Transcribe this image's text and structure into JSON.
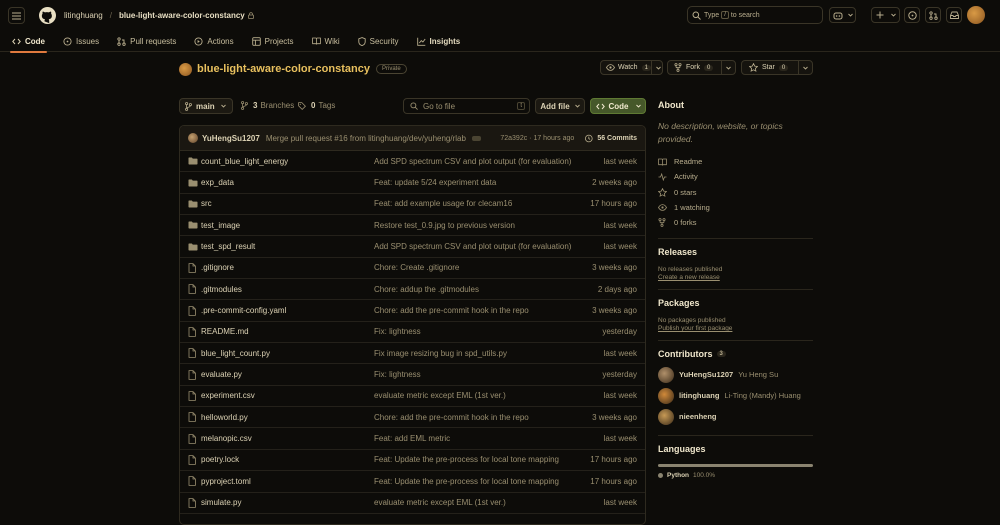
{
  "header": {
    "owner": "litinghuang",
    "separator": "/",
    "repo": "blue-light-aware-color-constancy",
    "search_prefix": "Type",
    "search_key": "/",
    "search_suffix": "to search"
  },
  "nav": {
    "tabs": [
      {
        "label": "Code",
        "icon": "code-icon"
      },
      {
        "label": "Issues",
        "icon": "issue-icon"
      },
      {
        "label": "Pull requests",
        "icon": "pull-request-icon"
      },
      {
        "label": "Actions",
        "icon": "play-icon"
      },
      {
        "label": "Projects",
        "icon": "table-icon"
      },
      {
        "label": "Wiki",
        "icon": "book-icon"
      },
      {
        "label": "Security",
        "icon": "shield-icon"
      },
      {
        "label": "Insights",
        "icon": "graph-icon"
      }
    ]
  },
  "repo": {
    "name": "blue-light-aware-color-constancy",
    "visibility": "Private",
    "watch_label": "Watch",
    "watch_count": "1",
    "fork_label": "Fork",
    "fork_count": "0",
    "star_label": "Star",
    "star_count": "0"
  },
  "toolbar": {
    "branch": "main",
    "branches_count": "3",
    "branches_label": "Branches",
    "tags_count": "0",
    "tags_label": "Tags",
    "goto_placeholder": "Go to file",
    "goto_key": "t",
    "add_file": "Add file",
    "code": "Code"
  },
  "latest_commit": {
    "user": "YuHengSu1207",
    "message": "Merge pull request #16 from litinghuang/dev/yuheng/rlab",
    "hash_time": "72a392c · 17 hours ago",
    "commits": "56 Commits"
  },
  "files": [
    {
      "type": "dir",
      "name": "count_blue_light_energy",
      "message": "Add SPD spectrum CSV and plot output (for evaluation)",
      "time": "last week"
    },
    {
      "type": "dir",
      "name": "exp_data",
      "message": "Feat: update 5/24 experiment data",
      "time": "2 weeks ago"
    },
    {
      "type": "dir",
      "name": "src",
      "message": "Feat: add example usage for clecam16",
      "time": "17 hours ago"
    },
    {
      "type": "dir",
      "name": "test_image",
      "message": "Restore test_0.9.jpg to previous version",
      "time": "last week"
    },
    {
      "type": "dir",
      "name": "test_spd_result",
      "message": "Add SPD spectrum CSV and plot output (for evaluation)",
      "time": "last week"
    },
    {
      "type": "file",
      "name": ".gitignore",
      "message": "Chore: Create .gitignore",
      "time": "3 weeks ago"
    },
    {
      "type": "file",
      "name": ".gitmodules",
      "message": "Chore: addup the .gitmodules",
      "time": "2 days ago"
    },
    {
      "type": "file",
      "name": ".pre-commit-config.yaml",
      "message": "Chore: add the pre-commit hook in the repo",
      "time": "3 weeks ago"
    },
    {
      "type": "file",
      "name": "README.md",
      "message": "Fix: lightness",
      "time": "yesterday"
    },
    {
      "type": "file",
      "name": "blue_light_count.py",
      "message": "Fix image resizing bug in spd_utils.py",
      "time": "last week"
    },
    {
      "type": "file",
      "name": "evaluate.py",
      "message": "Fix: lightness",
      "time": "yesterday"
    },
    {
      "type": "file",
      "name": "experiment.csv",
      "message": "evaluate metric except EML (1st ver.)",
      "time": "last week"
    },
    {
      "type": "file",
      "name": "helloworld.py",
      "message": "Chore: add the pre-commit hook in the repo",
      "time": "3 weeks ago"
    },
    {
      "type": "file",
      "name": "melanopic.csv",
      "message": "Feat: add EML metric",
      "time": "last week"
    },
    {
      "type": "file",
      "name": "poetry.lock",
      "message": "Feat: Update the pre-process for local tone mapping",
      "time": "17 hours ago"
    },
    {
      "type": "file",
      "name": "pyproject.toml",
      "message": "Feat: Update the pre-process for local tone mapping",
      "time": "17 hours ago"
    },
    {
      "type": "file",
      "name": "simulate.py",
      "message": "evaluate metric except EML (1st ver.)",
      "time": "last week"
    }
  ],
  "sidebar": {
    "about_title": "About",
    "description": "No description, website, or topics provided.",
    "items": [
      {
        "icon": "book-icon",
        "label": "Readme"
      },
      {
        "icon": "pulse-icon",
        "label": "Activity"
      },
      {
        "icon": "star-icon",
        "label": "0 stars"
      },
      {
        "icon": "eye-icon",
        "label": "1 watching"
      },
      {
        "icon": "fork-icon",
        "label": "0 forks"
      }
    ],
    "releases_title": "Releases",
    "releases_empty": "No releases published",
    "releases_link": "Create a new release",
    "packages_title": "Packages",
    "packages_empty": "No packages published",
    "packages_link": "Publish your first package",
    "contributors_title": "Contributors",
    "contributors_count": "3",
    "contributors": [
      {
        "user": "YuHengSu1207",
        "full": "Yu Heng Su",
        "color": "#b0906a"
      },
      {
        "user": "litinghuang",
        "full": "Li-Ting (Mandy) Huang",
        "color": "#d18a3a"
      },
      {
        "user": "nieenheng",
        "full": "",
        "color": "#c79a55"
      }
    ],
    "languages_title": "Languages",
    "language": "Python",
    "language_pct": "100.0%"
  }
}
